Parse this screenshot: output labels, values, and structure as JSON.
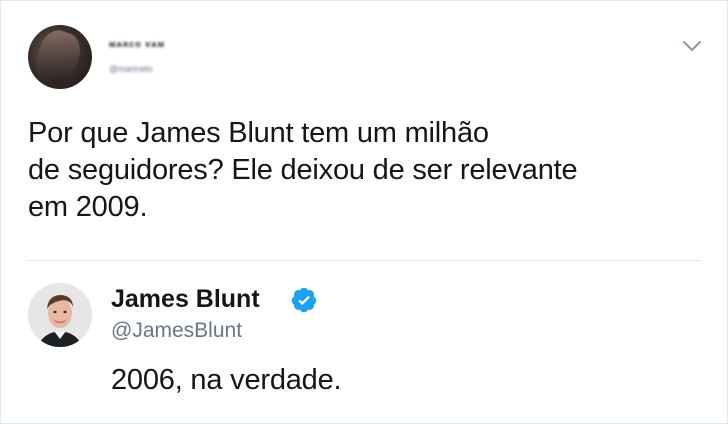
{
  "original_tweet": {
    "author_name": "ᴍᴀʀᴄᴏ ᴠᴀᴍ",
    "author_handle": "@marinelo",
    "text": "Por que James Blunt tem um milhão\nde seguidores? Ele deixou de ser relevante\nem 2009."
  },
  "reply": {
    "author_name": "James Blunt",
    "author_handle": "@JamesBlunt",
    "text": "2006, na verdade."
  },
  "icons": {
    "menu": "chevron-down-icon",
    "verified": "verified-badge-icon"
  },
  "colors": {
    "text": "#14171a",
    "secondary": "#657786",
    "verified": "#1da1f2",
    "divider": "#e1e8ed"
  }
}
